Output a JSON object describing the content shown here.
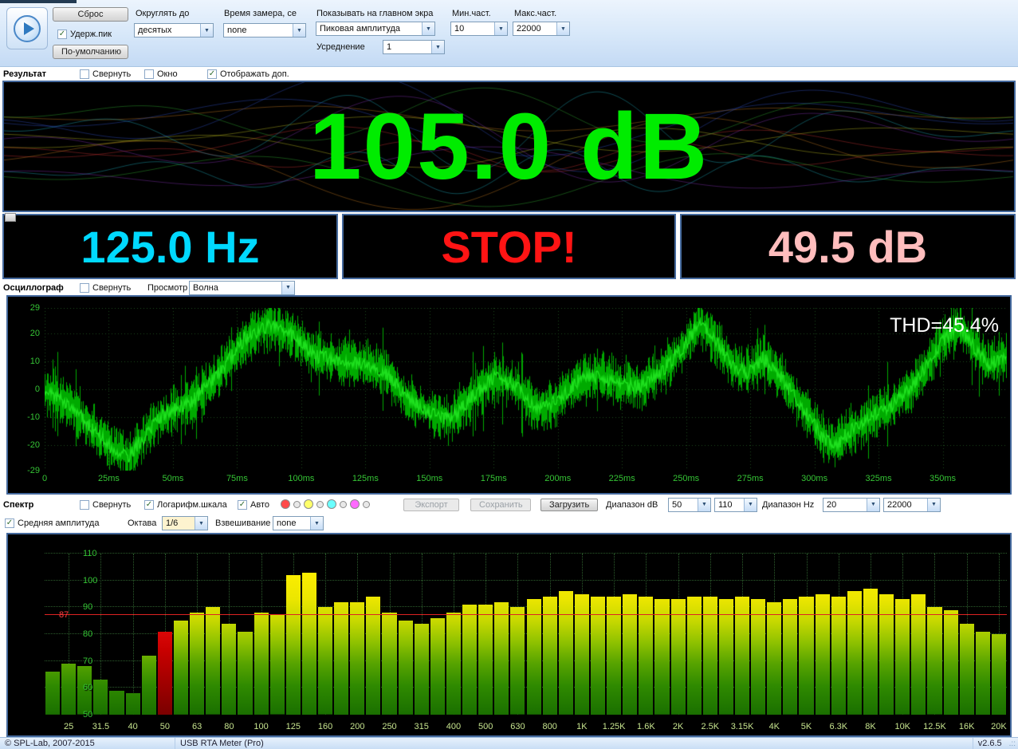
{
  "window": {
    "statusbar": {
      "copyright": "© SPL-Lab, 2007-2015",
      "app_name": "USB RTA Meter (Pro)",
      "version": "v2.6.5",
      "grip": ".::"
    }
  },
  "toolbar": {
    "reset_label": "Сброс",
    "hold_peak_label": "Удерж.пик",
    "defaults_label": "По-умолчанию",
    "round_to_label": "Округлять до",
    "round_to_value": "десятых",
    "measure_time_label": "Время замера, се",
    "measure_time_value": "none",
    "show_on_main_label": "Показывать на главном экра",
    "show_on_main_value": "Пиковая амплитуда",
    "averaging_label": "Усреднение",
    "averaging_value": "1",
    "min_freq_label": "Мин.част.",
    "min_freq_value": "10",
    "max_freq_label": "Макс.част.",
    "max_freq_value": "22000"
  },
  "result": {
    "title": "Результат",
    "collapse_label": "Свернуть",
    "window_label": "Окно",
    "show_extra_label": "Отображать доп.",
    "main_value": "105.0 dB",
    "freq_value": "125.0 Hz",
    "status_value": "STOP!",
    "avg_value": "49.5 dB",
    "freq_color": "#00d9ff",
    "status_color": "#ff1414",
    "avg_color": "#ffbdbd",
    "main_color": "#00ec00",
    "art_colors": [
      "#c03030",
      "#c07820",
      "#b8b820",
      "#30a830",
      "#20a8b8",
      "#3050c0",
      "#8030b0"
    ]
  },
  "oscilloscope": {
    "title": "Осциллограф",
    "collapse_label": "Свернуть",
    "view_label": "Просмотр",
    "view_value": "Волна",
    "thd_label": "THD=45.4%"
  },
  "spectrum": {
    "title": "Спектр",
    "collapse_label": "Свернуть",
    "log_scale_label": "Логарифм.шкала",
    "auto_label": "Авто",
    "export_label": "Экспорт",
    "save_label": "Сохранить",
    "load_label": "Загрузить",
    "range_db_label": "Диапазон dB",
    "range_db_min": "50",
    "range_db_max": "110",
    "range_hz_label": "Диапазон Hz",
    "range_hz_min": "20",
    "range_hz_max": "22000",
    "avg_amplitude_label": "Средняя амплитуда",
    "octave_label": "Октава",
    "octave_value": "1/6",
    "weighting_label": "Взвешивание",
    "weighting_value": "none",
    "threshold_label": "87",
    "palette_dots": [
      "#ff4a4a",
      "#e8e8e8",
      "#ffff6a",
      "#e8e8e8",
      "#6affff",
      "#e8e8e8",
      "#ff6aff",
      "#e8e8e8"
    ]
  },
  "chart_data": [
    {
      "type": "bar",
      "title": "RTA spectrum, 1/6 octave",
      "ylabel": "dB",
      "ylim": [
        50,
        110
      ],
      "y_ticks": [
        110,
        100,
        90,
        80,
        70,
        60,
        50
      ],
      "threshold_db": 87,
      "categories": [
        "25",
        "31.5",
        "40",
        "50",
        "63",
        "80",
        "100",
        "125",
        "160",
        "200",
        "250",
        "315",
        "400",
        "500",
        "630",
        "800",
        "1K",
        "1.25K",
        "1.6K",
        "2K",
        "2.5K",
        "3.15K",
        "4K",
        "5K",
        "6.3K",
        "8K",
        "10K",
        "12.5K",
        "16K",
        "20K"
      ],
      "bars_per_label": 2,
      "values": [
        66,
        69,
        68,
        63,
        59,
        58,
        72,
        81,
        85,
        88,
        90,
        84,
        81,
        88,
        87,
        102,
        103,
        90,
        92,
        92,
        94,
        88,
        85,
        84,
        86,
        88,
        91,
        91,
        92,
        90,
        93,
        94,
        96,
        95,
        94,
        94,
        95,
        94,
        93,
        93,
        94,
        94,
        93,
        94,
        93,
        92,
        93,
        94,
        95,
        94,
        96,
        97,
        95,
        93,
        95,
        90,
        89,
        84,
        81,
        80
      ],
      "red_bar_index": 7,
      "grid": true,
      "legend": false
    },
    {
      "type": "line",
      "title": "Волна (oscilloscope waveform)",
      "ylim": [
        -29,
        29
      ],
      "y_ticks": [
        29,
        20,
        10,
        0,
        -10,
        -20,
        -29
      ],
      "x_ticks": [
        "0",
        "25ms",
        "50ms",
        "75ms",
        "100ms",
        "125ms",
        "150ms",
        "175ms",
        "200ms",
        "225ms",
        "250ms",
        "275ms",
        "300ms",
        "325ms",
        "350ms"
      ],
      "x_tick_interval_ms": 25,
      "x_total_ms": 375,
      "envelope_ms_value": [
        [
          0,
          0
        ],
        [
          10,
          -6
        ],
        [
          25,
          -20
        ],
        [
          33,
          -24
        ],
        [
          45,
          -10
        ],
        [
          58,
          -4
        ],
        [
          68,
          6
        ],
        [
          78,
          18
        ],
        [
          88,
          23
        ],
        [
          97,
          19
        ],
        [
          105,
          12
        ],
        [
          115,
          10
        ],
        [
          125,
          9
        ],
        [
          133,
          6
        ],
        [
          142,
          -4
        ],
        [
          152,
          -9
        ],
        [
          158,
          -11
        ],
        [
          167,
          -2
        ],
        [
          175,
          4
        ],
        [
          183,
          2
        ],
        [
          192,
          -7
        ],
        [
          200,
          -4
        ],
        [
          208,
          3
        ],
        [
          216,
          5
        ],
        [
          224,
          2
        ],
        [
          232,
          1
        ],
        [
          240,
          6
        ],
        [
          248,
          14
        ],
        [
          255,
          23
        ],
        [
          262,
          17
        ],
        [
          268,
          8
        ],
        [
          274,
          6
        ],
        [
          280,
          11
        ],
        [
          287,
          4
        ],
        [
          295,
          -6
        ],
        [
          303,
          -17
        ],
        [
          308,
          -20
        ],
        [
          315,
          -14
        ],
        [
          322,
          -10
        ],
        [
          330,
          -6
        ],
        [
          338,
          1
        ],
        [
          344,
          9
        ],
        [
          350,
          17
        ],
        [
          356,
          23
        ],
        [
          362,
          15
        ],
        [
          368,
          9
        ],
        [
          375,
          12
        ]
      ],
      "noise_amplitude": 6
    }
  ]
}
